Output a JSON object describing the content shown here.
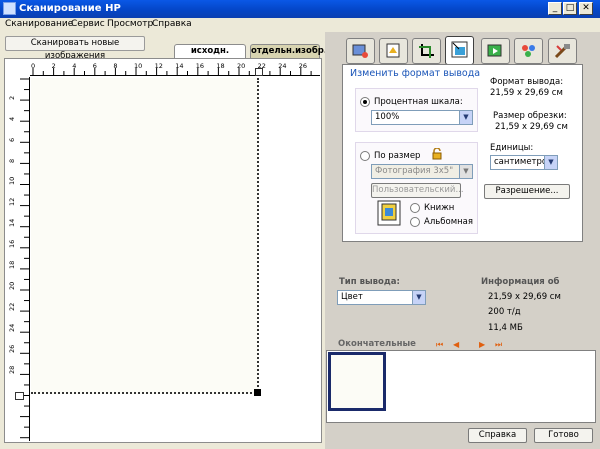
{
  "window": {
    "title": "Сканирование HP",
    "min": "_",
    "max": "□",
    "close": "✕"
  },
  "menu": [
    "Сканирование",
    "Сервис",
    "Просмотр",
    "Справка"
  ],
  "left": {
    "scan_new_label": "Сканировать новые изображения",
    "tabs": [
      "исходн. изобр.",
      "отдельн.изобр."
    ],
    "hruler_labels": [
      "0",
      "2",
      "4",
      "6",
      "8",
      "10",
      "12",
      "14",
      "16",
      "18",
      "20",
      "22",
      "24",
      "26"
    ],
    "vruler_labels": [
      "2",
      "4",
      "6",
      "8",
      "10",
      "12",
      "14",
      "16",
      "18",
      "20",
      "22",
      "24",
      "26",
      "28"
    ]
  },
  "toolbar": {
    "icons": [
      "output-type-icon",
      "color-adjust-icon",
      "crop-icon",
      "resize-icon",
      "sharpen-icon",
      "descreen-icon",
      "tools-icon"
    ],
    "active_index": 3
  },
  "resize": {
    "title": "Изменить формат вывода",
    "percent_label": "Процентная шкала:",
    "percent_value": "100%",
    "by_size_label": "По размер",
    "size_value": "Фотография 3x5\"",
    "custom_label": "Пользовательский...",
    "portrait_label": "Книжн",
    "landscape_label": "Альбомная",
    "output_format_label": "Формат вывода:",
    "output_format_value": "21,59 x 29,69 см",
    "crop_size_label": "Размер обрезки:",
    "crop_size_value": "21,59 x 29,69 см",
    "units_label": "Единицы:",
    "units_value": "сантиметро",
    "resolution_label": "Разрешение..."
  },
  "output": {
    "type_label": "Тип вывода:",
    "type_value": "Цвет",
    "info_label": "Информация об",
    "info_size": "21,59 x 29,69 см",
    "info_dpi": "200 т/д",
    "info_filesize": "11,4 МБ"
  },
  "finals": {
    "label": "Окончательные"
  },
  "buttons": {
    "help": "Справка",
    "done": "Готово"
  }
}
